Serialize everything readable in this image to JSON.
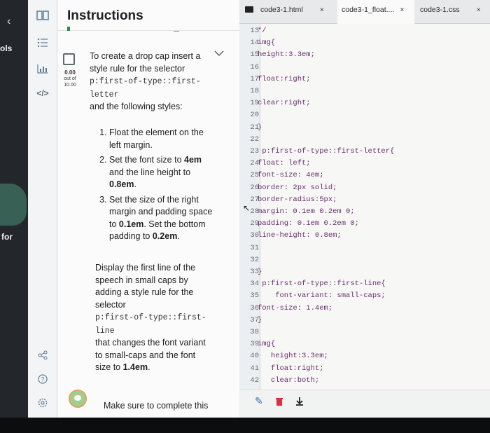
{
  "left_strip": {
    "text1": "ols",
    "text2": "for",
    "chevron": "‹"
  },
  "rail": {
    "icons": [
      "book-icon",
      "list-icon",
      "chart-icon",
      "code-icon",
      "share-icon",
      "help-icon",
      "settings-icon"
    ],
    "code_glyph": "</>"
  },
  "instructions": {
    "title": "Instructions",
    "score": {
      "value": "0.00",
      "out_of": "out of",
      "max": "10.00"
    },
    "intro_pre": "To create a drop cap insert a style rule for the selector",
    "intro_code": "p:first-of-type::first-letter",
    "intro_post": "and the following styles:",
    "steps": [
      {
        "pre": "Float the element on the left margin.",
        "b1": "",
        "mid": "",
        "b2": ""
      },
      {
        "pre": "Set the font size to ",
        "b1": "4em",
        "mid": " and the line height to ",
        "b2": "0.8em"
      },
      {
        "pre": "Set the size of the right margin and padding space to ",
        "b1": "0.1em",
        "mid": ". Set the bottom padding to ",
        "b2": "0.2em"
      }
    ],
    "step_end_suffix": ".",
    "para2_pre": "Display the first line of the speech in small caps by adding a style rule for the selector",
    "para2_code": "p:first-of-type::first-line",
    "para2_mid": "that changes the font variant to small-caps and the font size to ",
    "para2_bold": "1.4em",
    "para2_end": ".",
    "footer_text": "Make sure to complete this"
  },
  "editor": {
    "tabs": [
      {
        "label": "code3-1.html",
        "close": "×"
      },
      {
        "label": "code3-1_float....",
        "close": "×"
      },
      {
        "label": "code3-1.css",
        "close": "×"
      }
    ],
    "lines": [
      {
        "n": "13",
        "t": "*/"
      },
      {
        "n": "14",
        "t": "img{"
      },
      {
        "n": "15",
        "t": "height:3.3em;"
      },
      {
        "n": "16",
        "t": ""
      },
      {
        "n": "17",
        "t": "float:right;"
      },
      {
        "n": "18",
        "t": ""
      },
      {
        "n": "19",
        "t": "clear:right;"
      },
      {
        "n": "20",
        "t": ""
      },
      {
        "n": "21",
        "t": "}"
      },
      {
        "n": "22",
        "t": ""
      },
      {
        "n": "23",
        "t": " p:first-of-type::first-letter{"
      },
      {
        "n": "24",
        "t": "float: left;"
      },
      {
        "n": "25",
        "t": "font-size: 4em;"
      },
      {
        "n": "26",
        "t": "border: 2px solid;"
      },
      {
        "n": "27",
        "t": "border-radius:5px;"
      },
      {
        "n": "28",
        "t": "margin: 0.1em 0.2em 0;"
      },
      {
        "n": "29",
        "t": "padding: 0.1em 0.2em 0;"
      },
      {
        "n": "30",
        "t": "line-height: 0.8em;"
      },
      {
        "n": "31",
        "t": ""
      },
      {
        "n": "32",
        "t": ""
      },
      {
        "n": "33",
        "t": "}"
      },
      {
        "n": "34",
        "t": " p:first-of-type::first-line{"
      },
      {
        "n": "35",
        "t": "    font-variant: small-caps;"
      },
      {
        "n": "36",
        "t": "font-size: 1.4em;"
      },
      {
        "n": "37",
        "t": "}"
      },
      {
        "n": "38",
        "t": ""
      },
      {
        "n": "39",
        "t": "img{"
      },
      {
        "n": "40",
        "t": "   height:3.3em;"
      },
      {
        "n": "41",
        "t": "   float:right;"
      },
      {
        "n": "42",
        "t": "   clear:both;"
      }
    ],
    "footer_icons": [
      "pencil-icon",
      "trash-icon",
      "download-icon"
    ]
  },
  "colors": {
    "code_purple": "#6a2e6e",
    "accent_green": "#2a8a48",
    "trash_red": "#d8323c",
    "file_icon": "#222222"
  }
}
